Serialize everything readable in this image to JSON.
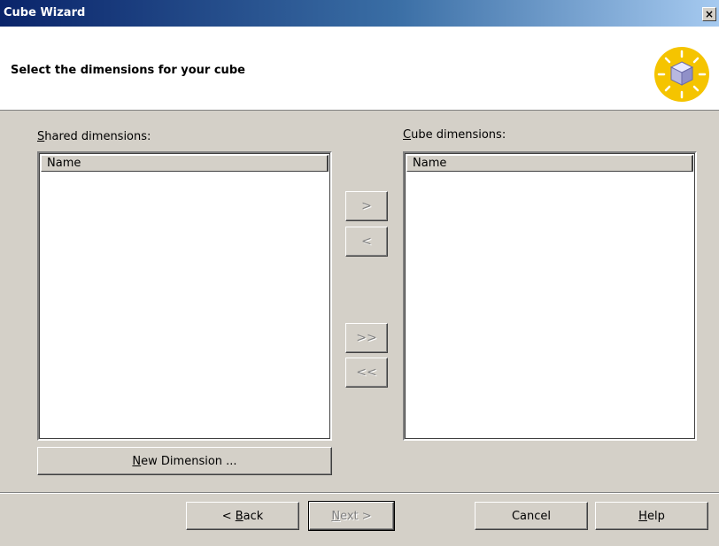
{
  "window": {
    "title": "Cube Wizard",
    "close_glyph": "×"
  },
  "header": {
    "title": "Select the dimensions for your cube",
    "icon": "cube-wizard-icon"
  },
  "shared": {
    "label_mn": "S",
    "label_rest": "hared dimensions:",
    "column": "Name",
    "new_dimension_mn": "N",
    "new_dimension_rest": "ew Dimension ..."
  },
  "cube": {
    "label_mn": "C",
    "label_rest": "ube dimensions:",
    "column": "Name"
  },
  "transfer": {
    "add": ">",
    "remove": "<",
    "add_all": ">>",
    "remove_all": "<<"
  },
  "footer": {
    "back_pre": "< ",
    "back_mn": "B",
    "back_rest": "ack",
    "next_mn": "N",
    "next_rest": "ext >",
    "cancel": "Cancel",
    "help_mn": "H",
    "help_rest": "elp"
  },
  "colors": {
    "titlebar_start": "#0a246a",
    "face": "#d4d0c8",
    "icon_yellow": "#f5c400"
  }
}
